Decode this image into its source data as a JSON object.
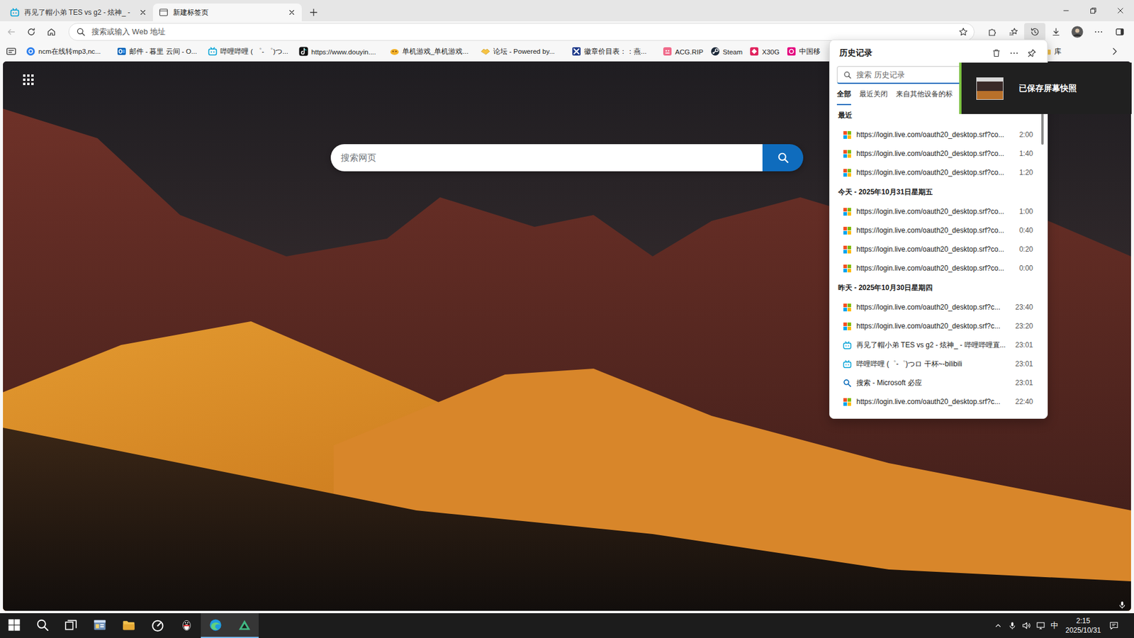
{
  "browser_tabs": [
    {
      "label": "再见了帽小弟 TES vs g2 - 炫神_ -",
      "kind": "bili",
      "selected": false
    },
    {
      "label": "新建标签页",
      "kind": "newtab",
      "selected": true
    }
  ],
  "address_bar": {
    "placeholder": "搜索或输入 Web 地址"
  },
  "toolbar": {
    "back_disabled": true,
    "history_open": true
  },
  "bookmarks": [
    {
      "label": "ncm在线转mp3,nc...",
      "kind": "ncm"
    },
    {
      "label": "邮件 - 暮里 云间 - O...",
      "kind": "outlook"
    },
    {
      "label": "哔哩哔哩 ( ゜- ゜)つ...",
      "kind": "bili"
    },
    {
      "label": "https://www.douyin....",
      "kind": "douyin"
    },
    {
      "label": "单机游戏_单机游戏...",
      "kind": "game"
    },
    {
      "label": "论坛 - Powered by...",
      "kind": "forum"
    },
    {
      "label": "徽章价目表：：燕...",
      "kind": "badge"
    },
    {
      "label": "ACG.RIP",
      "kind": "acg"
    },
    {
      "label": "Steam",
      "kind": "steam"
    },
    {
      "label": "X30G",
      "kind": "x30g"
    },
    {
      "label": "中国移",
      "kind": "mobile"
    }
  ],
  "bookmarks_folder": {
    "label": "库"
  },
  "new_tab_page": {
    "search_placeholder": "搜索网页"
  },
  "history_panel": {
    "title": "历史记录",
    "search_placeholder": "搜索 历史记录",
    "tabs": [
      {
        "label": "全部",
        "selected": true
      },
      {
        "label": "最近关闭",
        "selected": false
      },
      {
        "label": "来自其他设备的标",
        "selected": false
      }
    ],
    "scrollbar": {
      "level": 0.12
    },
    "sections": [
      {
        "heading": "最近",
        "items": [
          {
            "title": "https://login.live.com/oauth20_desktop.srf?co...",
            "time": "2:00",
            "kind": "ms"
          },
          {
            "title": "https://login.live.com/oauth20_desktop.srf?co...",
            "time": "1:40",
            "kind": "ms"
          },
          {
            "title": "https://login.live.com/oauth20_desktop.srf?co...",
            "time": "1:20",
            "kind": "ms"
          }
        ]
      },
      {
        "heading": "今天 - 2025年10月31日星期五",
        "items": [
          {
            "title": "https://login.live.com/oauth20_desktop.srf?co...",
            "time": "1:00",
            "kind": "ms"
          },
          {
            "title": "https://login.live.com/oauth20_desktop.srf?co...",
            "time": "0:40",
            "kind": "ms"
          },
          {
            "title": "https://login.live.com/oauth20_desktop.srf?co...",
            "time": "0:20",
            "kind": "ms"
          },
          {
            "title": "https://login.live.com/oauth20_desktop.srf?co...",
            "time": "0:00",
            "kind": "ms"
          }
        ]
      },
      {
        "heading": "昨天 - 2025年10月30日星期四",
        "items": [
          {
            "title": "https://login.live.com/oauth20_desktop.srf?c...",
            "time": "23:40",
            "kind": "ms"
          },
          {
            "title": "https://login.live.com/oauth20_desktop.srf?c...",
            "time": "23:20",
            "kind": "ms"
          },
          {
            "title": "再见了帽小弟 TES vs g2 - 炫神_ - 哔哩哔哩直...",
            "time": "23:01",
            "kind": "bili"
          },
          {
            "title": "哔哩哔哩 (゜-゜)つロ 干杯~-bilibili",
            "time": "23:01",
            "kind": "bili"
          },
          {
            "title": "搜索 - Microsoft 必应",
            "time": "23:01",
            "kind": "search"
          },
          {
            "title": "https://login.live.com/oauth20_desktop.srf?c...",
            "time": "22:40",
            "kind": "ms"
          }
        ]
      }
    ]
  },
  "toast": {
    "message": "已保存屏幕快照"
  },
  "taskbar": {
    "buttons": [
      {
        "kind": "start",
        "active": false
      },
      {
        "kind": "find",
        "active": false
      },
      {
        "kind": "taskview",
        "active": false
      },
      {
        "kind": "panel",
        "active": false
      },
      {
        "kind": "explorer",
        "active": false
      },
      {
        "kind": "gauge",
        "active": false
      },
      {
        "kind": "qq",
        "active": false
      },
      {
        "kind": "edge",
        "active": true
      },
      {
        "kind": "triangle",
        "active": true
      }
    ],
    "tray": {
      "ime": "中",
      "time": "2:15",
      "date": "2025/10/31"
    }
  }
}
